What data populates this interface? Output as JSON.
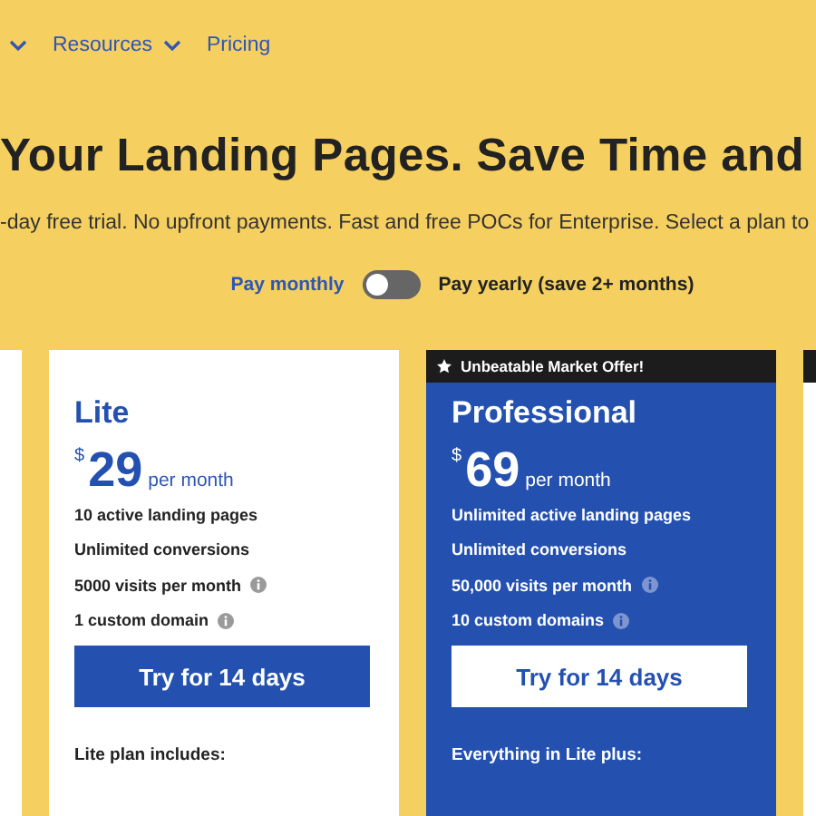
{
  "nav": [
    {
      "dropdown": true
    },
    {
      "label": "Resources",
      "dropdown": true
    },
    {
      "label": "Pricing",
      "dropdown": false
    }
  ],
  "heading": "Your Landing Pages. Save Time and",
  "subtitle": "-day free trial. No upfront payments. Fast and free POCs for Enterprise. Select a plan to",
  "billing": [
    {
      "label": "Pay monthly",
      "selected": true
    },
    {
      "label": "Pay yearly (save 2+ months)",
      "selected": false
    }
  ],
  "plans": [
    {
      "name": "Lite",
      "highlighted": false,
      "currency": "$",
      "price": "29",
      "period": "per month",
      "features": [
        {
          "text": "10 active landing pages",
          "info": false
        },
        {
          "text": "Unlimited conversions",
          "info": false
        },
        {
          "text": "5000 visits per month",
          "info": true
        },
        {
          "text": "1 custom domain",
          "info": true
        }
      ],
      "button": "Try for 14 days",
      "includes": "Lite plan includes:"
    },
    {
      "badge": "Unbeatable Market Offer!",
      "name": "Professional",
      "highlighted": true,
      "currency": "$",
      "price": "69",
      "period": "per month",
      "features": [
        {
          "text": "Unlimited active landing pages",
          "info": false
        },
        {
          "text": "Unlimited conversions",
          "info": false
        },
        {
          "text": "50,000 visits per month",
          "info": true
        },
        {
          "text": "10 custom domains",
          "info": true
        }
      ],
      "button": "Try for 14 days",
      "includes": "Everything in Lite plus:"
    }
  ]
}
